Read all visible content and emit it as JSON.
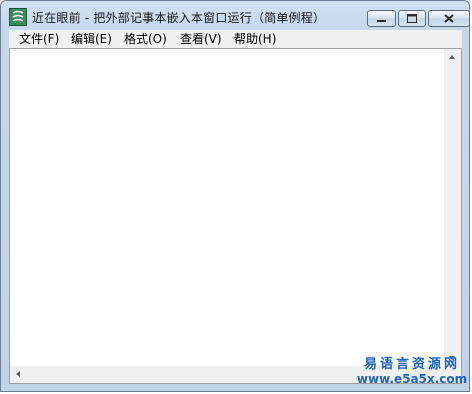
{
  "window": {
    "title": "近在眼前 - 把外部记事本嵌入本窗口运行（简单例程）",
    "icon": "app-icon",
    "controls": [
      "minimize-icon",
      "maximize-icon",
      "close-icon"
    ]
  },
  "menu": {
    "file": "文件(F)",
    "edit": "编辑(E)",
    "format": "格式(O)",
    "view": "查看(V)",
    "help": "帮助(H)"
  },
  "editor": {
    "text": "",
    "scrollbars": [
      "vertical",
      "horizontal"
    ]
  },
  "watermark": {
    "cn": "易语言资源网",
    "url": "www.e5a5x.com"
  },
  "colors": {
    "title_bar": "#c5d8ec",
    "watermark": "#1f64c8"
  }
}
